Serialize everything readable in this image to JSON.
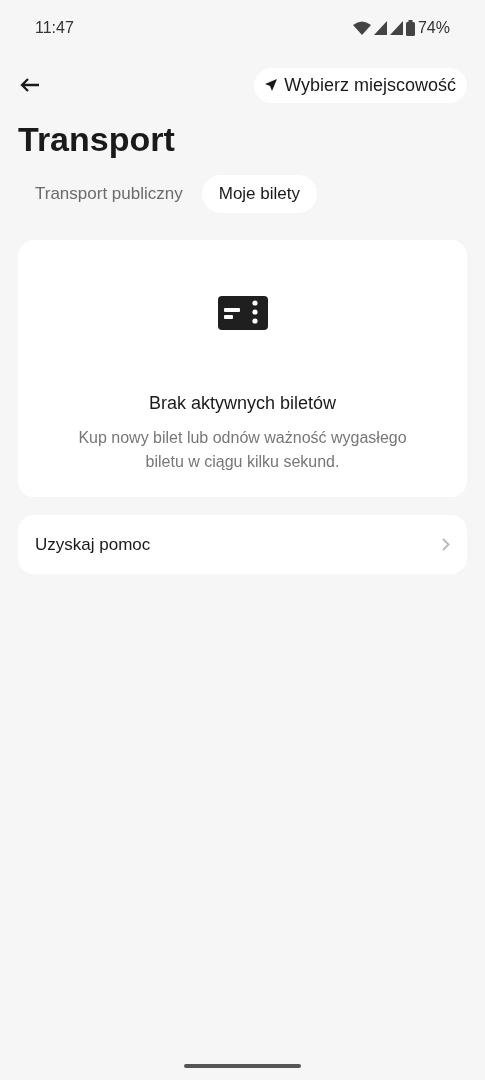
{
  "status_bar": {
    "time": "11:47",
    "battery": "74%"
  },
  "header": {
    "location_button": "Wybierz miejscowość"
  },
  "title": "Transport",
  "tabs": [
    {
      "label": "Transport publiczny",
      "selected": false
    },
    {
      "label": "Moje bilety",
      "selected": true
    }
  ],
  "empty_state": {
    "title": "Brak aktywnych biletów",
    "message": "Kup nowy bilet lub odnów ważność wygasłego biletu w ciągu kilku sekund."
  },
  "help_row": {
    "label": "Uzyskaj pomoc"
  }
}
